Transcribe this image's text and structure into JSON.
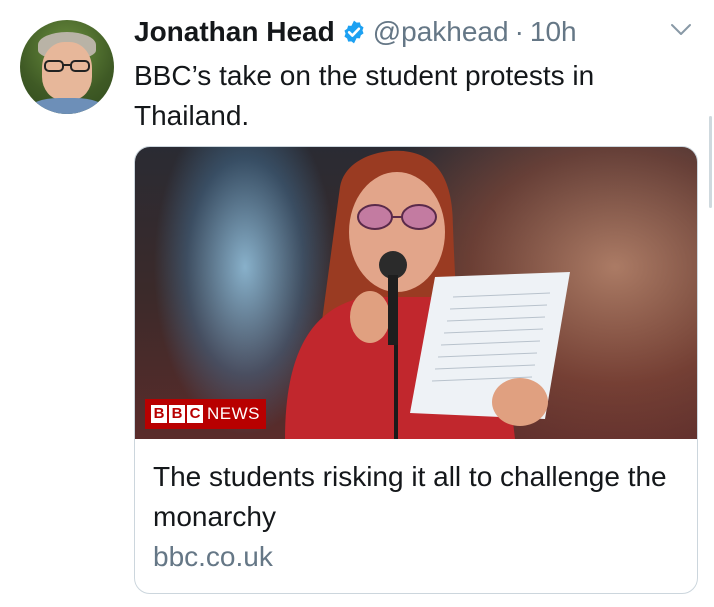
{
  "author": {
    "name": "Jonathan Head",
    "handle": "@pakhead",
    "separator": "·",
    "time": "10h",
    "verified_icon": "verified-badge-icon",
    "avatar_icon": "avatar-photo"
  },
  "tweet": {
    "text": "BBC’s take on the student protests in Thailand."
  },
  "card": {
    "badge": {
      "b1": "B",
      "b2": "B",
      "b3": "C",
      "news": "NEWS"
    },
    "title": "The students risking it all to challenge the monarchy",
    "domain": "bbc.co.uk",
    "image_icon": "news-photo"
  },
  "menu": {
    "icon": "chevron-down-icon"
  },
  "colors": {
    "text": "#14171a",
    "secondary": "#657786",
    "verified": "#1da1f2",
    "bbc_red": "#b80000",
    "border": "#ccd6dd"
  }
}
